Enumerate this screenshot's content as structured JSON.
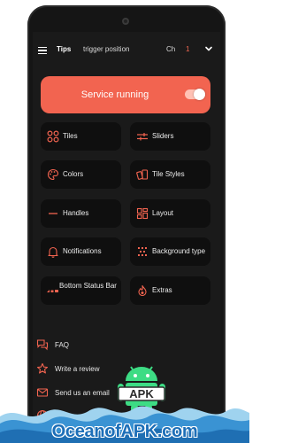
{
  "topbar": {
    "tips": "Tips",
    "trigger_position": "trigger position",
    "channel_label": "Ch",
    "channel_value": "1"
  },
  "service": {
    "label": "Service running",
    "enabled": true
  },
  "tiles": [
    {
      "label": "Tiles",
      "icon": "tiles-icon"
    },
    {
      "label": "Sliders",
      "icon": "sliders-icon"
    },
    {
      "label": "Colors",
      "icon": "palette-icon"
    },
    {
      "label": "Tile Styles",
      "icon": "tile-styles-icon"
    },
    {
      "label": "Handles",
      "icon": "handle-icon"
    },
    {
      "label": "Layout",
      "icon": "layout-icon"
    },
    {
      "label": "Notifications",
      "icon": "bell-icon"
    },
    {
      "label": "Background type",
      "icon": "background-icon"
    },
    {
      "label": "Bottom Status Bar",
      "icon": "status-bar-icon"
    },
    {
      "label": "Extras",
      "icon": "flame-icon"
    }
  ],
  "list": [
    {
      "label": "FAQ",
      "icon": "chat-icon"
    },
    {
      "label": "Write a review",
      "icon": "star-icon"
    },
    {
      "label": "Send us an email",
      "icon": "email-icon"
    },
    {
      "label": "",
      "icon": "globe-icon"
    }
  ],
  "watermark": {
    "badge": "APK",
    "text": "OceanofAPK.com"
  },
  "colors": {
    "accent": "#f26450",
    "background": "#1a1a1a",
    "tile": "#0f0f0f",
    "watermark": "#1d6fb8"
  }
}
